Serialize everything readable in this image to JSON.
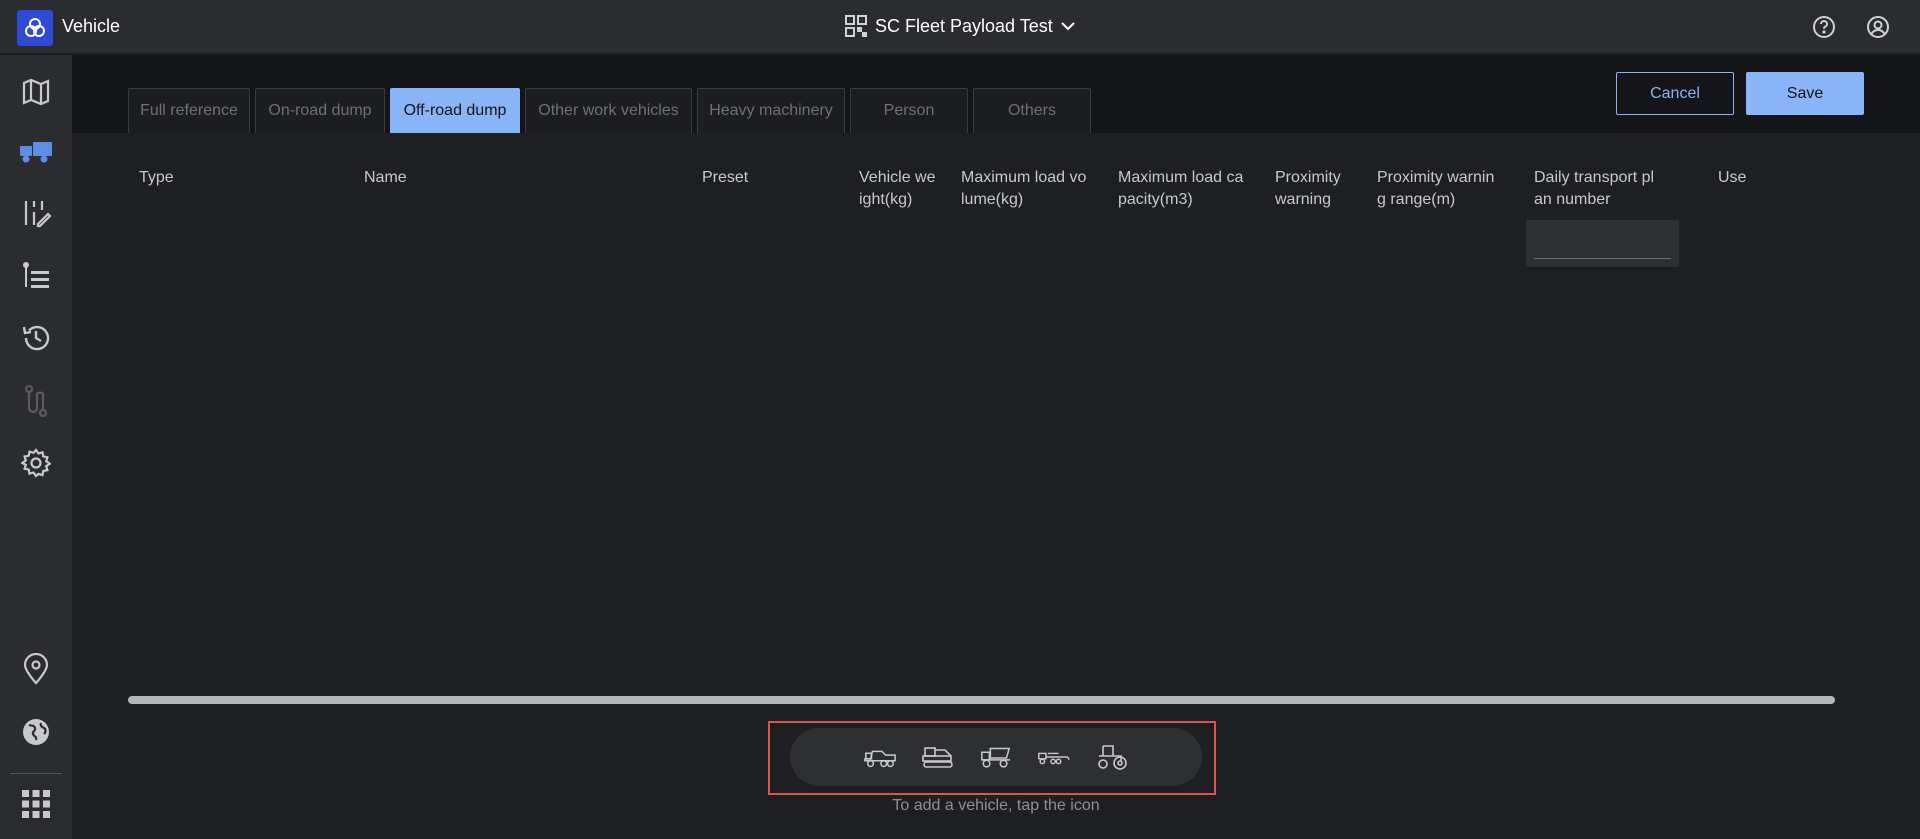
{
  "app": {
    "title": "Vehicle"
  },
  "project": {
    "name": "SC Fleet Payload Test"
  },
  "tabs": [
    {
      "label": "Full reference",
      "active": false
    },
    {
      "label": "On-road dump",
      "active": false
    },
    {
      "label": "Off-road dump",
      "active": true
    },
    {
      "label": "Other work vehicles",
      "active": false
    },
    {
      "label": "Heavy machinery",
      "active": false
    },
    {
      "label": "Person",
      "active": false
    },
    {
      "label": "Others",
      "active": false
    }
  ],
  "actions": {
    "cancel": "Cancel",
    "save": "Save"
  },
  "table": {
    "columns": [
      [
        "Type"
      ],
      [
        "Name"
      ],
      [
        "Preset"
      ],
      [
        "Vehicle we",
        "ight(kg)"
      ],
      [
        "Maximum load vo",
        "lume(kg)"
      ],
      [
        "Maximum load ca",
        "pacity(m3)"
      ],
      [
        "Proximity",
        "warning"
      ],
      [
        "Proximity warnin",
        "g range(m)"
      ],
      [
        "Daily transport pl",
        "an number"
      ],
      [
        "Use"
      ]
    ]
  },
  "add_vehicle": {
    "icons": [
      "rigid-dump-truck-icon",
      "excavator-icon",
      "articulated-dump-truck-icon",
      "trailer-truck-icon",
      "tractor-icon"
    ],
    "hint": "To add a vehicle, tap the icon"
  },
  "colors": {
    "accent": "#8ab4f8",
    "logo": "#2f4ad6",
    "highlight": "#e05349"
  }
}
